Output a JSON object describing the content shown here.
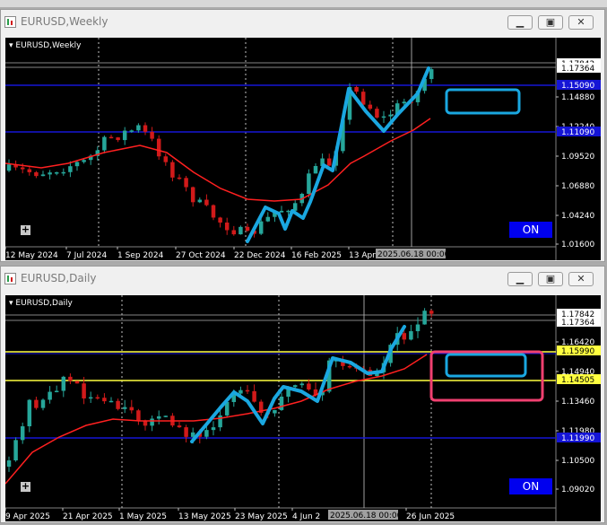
{
  "weekly": {
    "window_title": "EURUSD,Weekly",
    "symbol_label": "EURUSD,Weekly",
    "on_label": "ON",
    "price_labels": [
      "1.17842",
      "1.17364",
      "1.15090",
      "1.14880",
      "1.12240",
      "1.11090",
      "1.09520",
      "1.06880",
      "1.04240",
      "1.01600"
    ],
    "highlighted_prices": [
      "1.17842",
      "1.17364",
      "1.15090",
      "1.11090"
    ],
    "time_labels": [
      "12 May 2024",
      "7 Jul 2024",
      "1 Sep 2024",
      "27 Oct 2024",
      "22 Dec 2024",
      "16 Feb 2025",
      "13 Apr 2"
    ],
    "crosshair_time": "2025.06.18 00:00"
  },
  "daily": {
    "window_title": "EURUSD,Daily",
    "symbol_label": "EURUSD,Daily",
    "on_label": "ON",
    "price_labels": [
      "1.17842",
      "1.17364",
      "1.16420",
      "1.15990",
      "1.14940",
      "1.14505",
      "1.13460",
      "1.11980",
      "1.11990",
      "1.10500",
      "1.09020"
    ],
    "highlighted_prices": [
      "1.17842",
      "1.17364",
      "1.15990",
      "1.14505",
      "1.11990"
    ],
    "time_labels": [
      "9 Apr 2025",
      "21 Apr 2025",
      "1 May 2025",
      "13 May 2025",
      "23 May 2025",
      "4 Jun 2",
      "26 Jun 2025"
    ],
    "crosshair_time": "2025.06.18 00:00"
  },
  "colors": {
    "bull": "#26a69a",
    "bear": "#d11a1a",
    "ma": "#ff2020",
    "zigzag": "#1aa7e0",
    "level_blue": "#1515d6",
    "level_yellow": "#ffff40",
    "pink_box": "#f04070"
  }
}
